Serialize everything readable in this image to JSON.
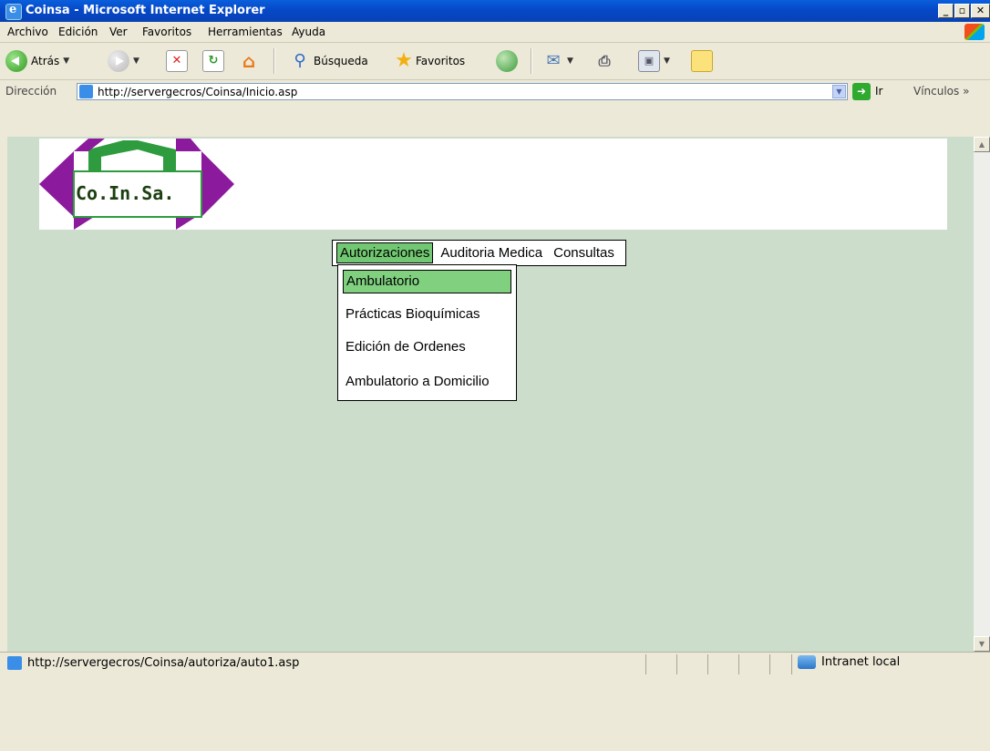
{
  "window": {
    "title": "Coinsa - Microsoft Internet Explorer"
  },
  "menubar": {
    "items": [
      "Archivo",
      "Edición",
      "Ver",
      "Favoritos",
      "Herramientas",
      "Ayuda"
    ]
  },
  "toolbar": {
    "back_label": "Atrás",
    "search_label": "Búsqueda",
    "favorites_label": "Favoritos"
  },
  "address": {
    "label": "Dirección",
    "url": "http://servergecros/Coinsa/Inicio.asp",
    "go_label": "Ir",
    "links_label": "Vínculos"
  },
  "page": {
    "logo_text": "Co.In.Sa.",
    "menu": {
      "items": [
        "Autorizaciones",
        "Auditoria Medica",
        "Consultas"
      ],
      "active": "Autorizaciones",
      "submenu": [
        "Ambulatorio",
        "Prácticas Bioquímicas",
        "Edición de Ordenes",
        "Ambulatorio a Domicilio"
      ],
      "submenu_highlighted": "Ambulatorio"
    },
    "colors": {
      "background": "#ccddcc",
      "menu_highlight": "#72c872",
      "logo_purple": "#8b1a9c",
      "logo_green": "#2e9c3e"
    }
  },
  "status": {
    "message": "http://servergecros/Coinsa/autoriza/auto1.asp",
    "zone": "Intranet local"
  }
}
